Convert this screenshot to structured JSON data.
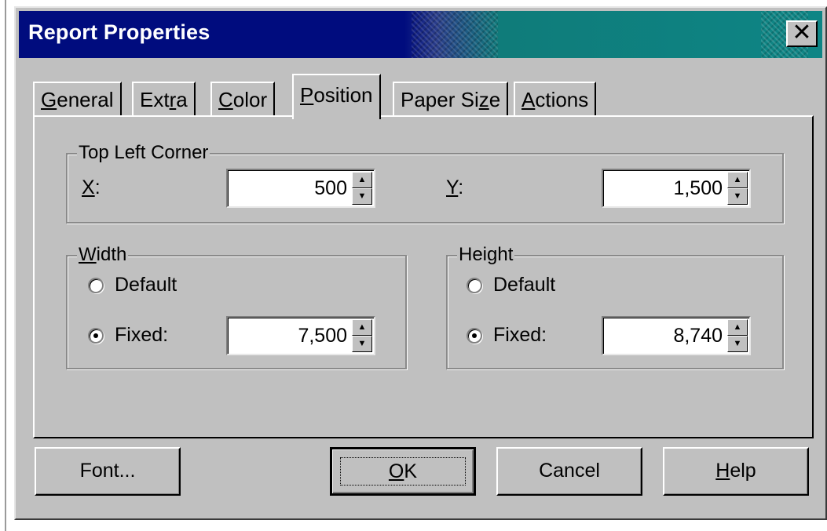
{
  "window": {
    "title": "Report Properties",
    "close_glyph": "✕"
  },
  "tabs": [
    {
      "pre": "",
      "key": "G",
      "post": "eneral",
      "active": false
    },
    {
      "pre": "Ext",
      "key": "r",
      "post": "a",
      "active": false
    },
    {
      "pre": "",
      "key": "C",
      "post": "olor",
      "active": false
    },
    {
      "pre": "",
      "key": "P",
      "post": "osition",
      "active": true
    },
    {
      "pre": "Paper Si",
      "key": "z",
      "post": "e",
      "active": false
    },
    {
      "pre": "",
      "key": "A",
      "post": "ctions",
      "active": false
    }
  ],
  "top_left": {
    "label": "Top Left Corner",
    "x": {
      "key": "X",
      "suffix": ":",
      "value": "500"
    },
    "y": {
      "key": "Y",
      "suffix": ":",
      "value": "1,500"
    }
  },
  "width": {
    "label_key": "W",
    "label_rest": "idth",
    "default_label": "Default",
    "fixed_label": "Fixed:",
    "selected": "fixed",
    "value": "7,500"
  },
  "height": {
    "label_pre": "Hei",
    "label_key": "g",
    "label_rest": "ht",
    "default_label": "Default",
    "fixed_label": "Fixed:",
    "selected": "fixed",
    "value": "8,740"
  },
  "buttons": {
    "font": "Font...",
    "ok_key": "O",
    "ok_rest": "K",
    "cancel": "Cancel",
    "help_key": "H",
    "help_rest": "elp"
  },
  "icons": {
    "spin_up": "▲",
    "spin_down": "▼"
  },
  "colors": {
    "titlebar_start": "#000c7e",
    "titlebar_end": "#0e8585",
    "face": "#c0c0c0"
  }
}
